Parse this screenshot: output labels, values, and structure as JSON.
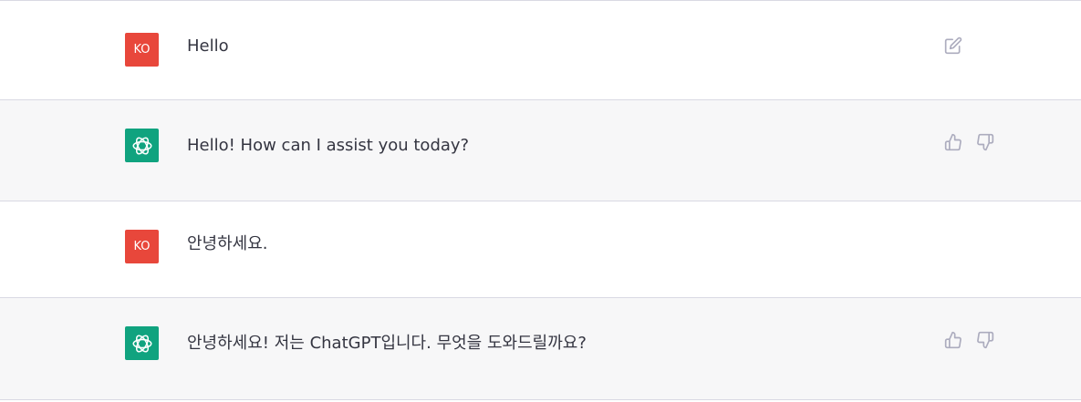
{
  "messages": [
    {
      "role": "user",
      "avatar_initials": "KO",
      "text": "Hello",
      "actions": [
        "edit-icon"
      ]
    },
    {
      "role": "assistant",
      "avatar_icon": "openai-logo-icon",
      "text": "Hello! How can I assist you today?",
      "actions": [
        "thumbs-up-icon",
        "thumbs-down-icon"
      ]
    },
    {
      "role": "user",
      "avatar_initials": "KO",
      "text": "안녕하세요.",
      "actions": []
    },
    {
      "role": "assistant",
      "avatar_icon": "openai-logo-icon",
      "text": "안녕하세요! 저는 ChatGPT입니다. 무엇을 도와드릴까요?",
      "actions": [
        "thumbs-up-icon",
        "thumbs-down-icon"
      ]
    }
  ],
  "colors": {
    "user_avatar": "#e8473b",
    "assistant_avatar": "#10a37f",
    "assistant_row_bg": "#f7f7f8",
    "divider": "#d9d9e3",
    "icon": "#acacbe"
  }
}
